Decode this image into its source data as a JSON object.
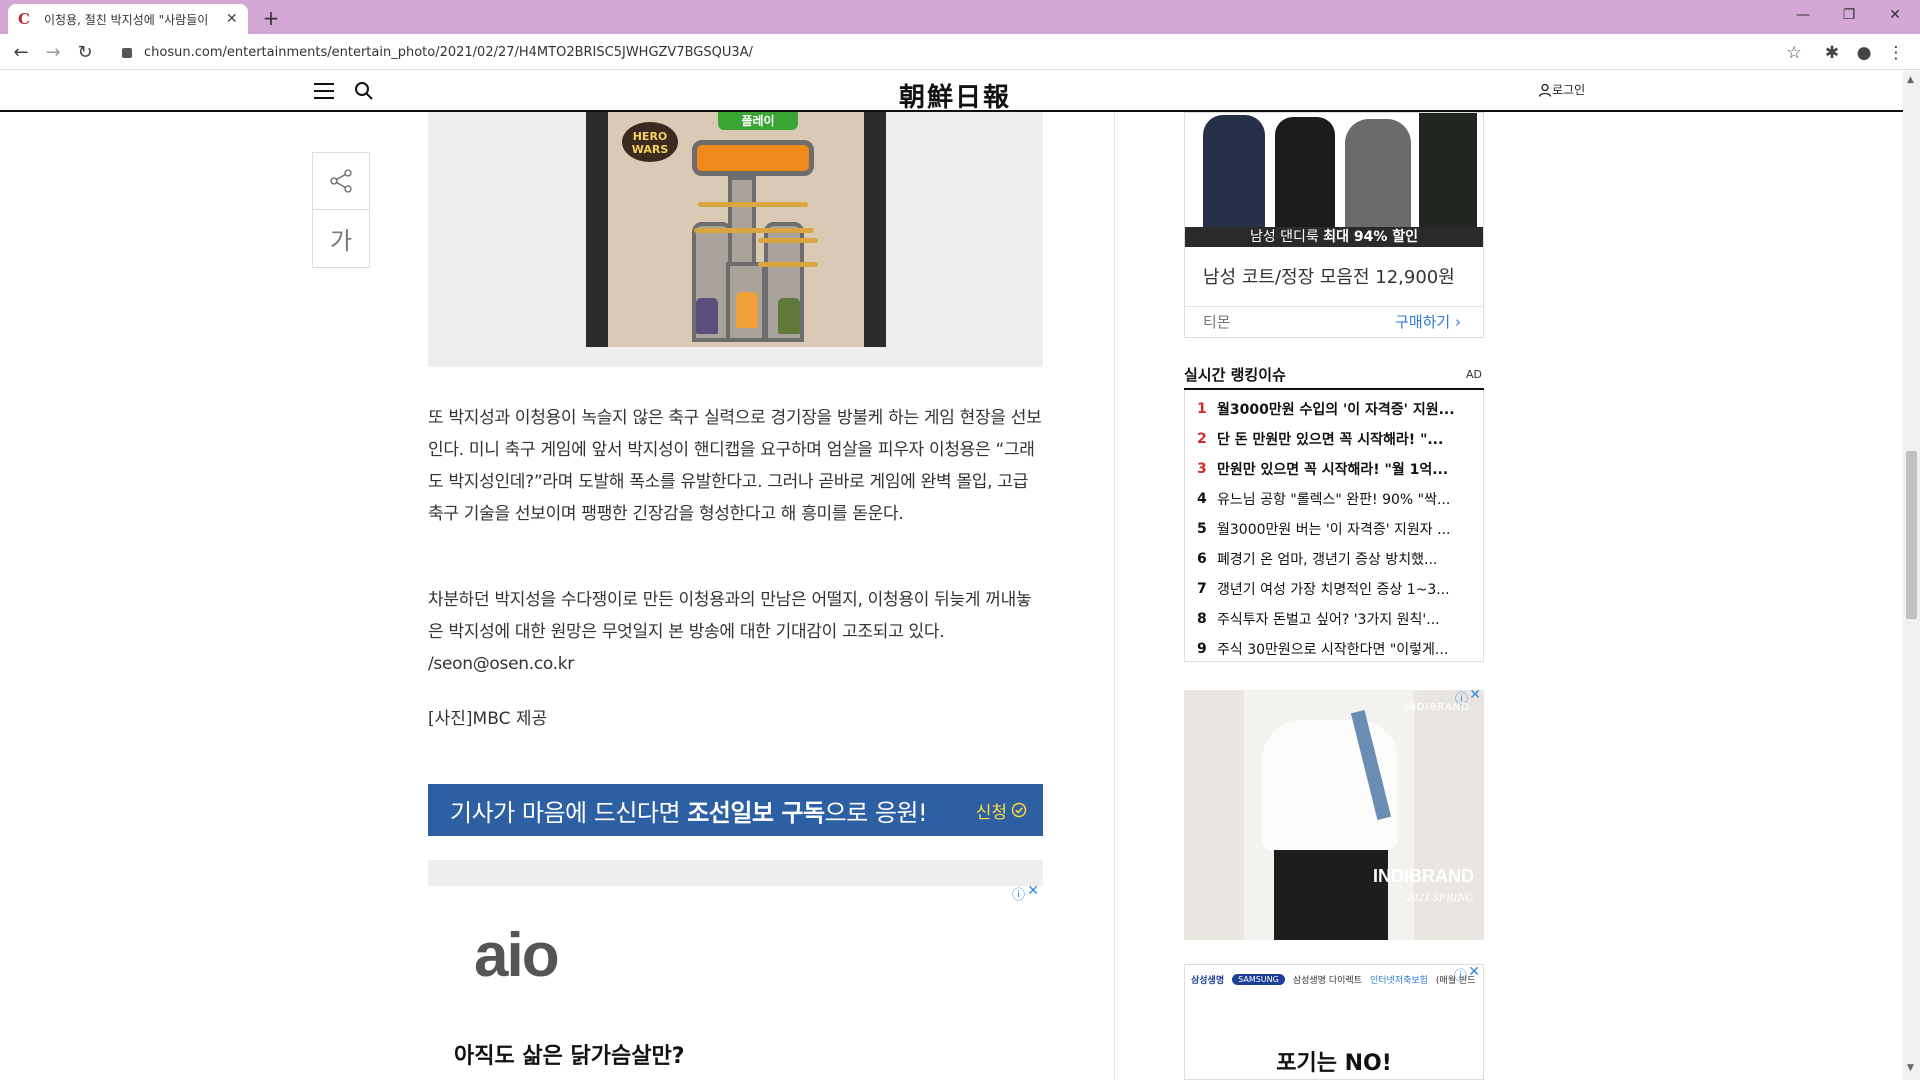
{
  "browser": {
    "tab_title": "이청용, 절친 박지성에 \"사람들이",
    "url": "chosun.com/entertainments/entertain_photo/2021/02/27/H4MTO2BRISC5JWHGZV7BGSQU3A/",
    "new_tab": "+",
    "tab_close": "✕"
  },
  "header": {
    "logo": "朝鮮日報",
    "login": "로그인"
  },
  "article": {
    "font_button": "가",
    "game_play": "플레이",
    "game_logo_1": "HERO",
    "game_logo_2": "WARS",
    "paragraph1": "또 박지성과 이청용이 녹슬지 않은 축구 실력으로 경기장을 방불케 하는 게임 현장을 선보인다. 미니 축구 게임에 앞서 박지성이 핸디캡을 요구하며 엄살을 피우자 이청용은 “그래도 박지성인데?”라며 도발해 폭소를 유발한다고. 그러나 곧바로 게임에 완벽 몰입, 고급 축구 기술을 선보이며 팽팽한 긴장감을 형성한다고 해 흥미를 돋운다.",
    "paragraph2": "차분하던 박지성을 수다쟁이로 만든 이청용과의 만남은 어떨지, 이청용이 뒤늦게 꺼내놓은 박지성에 대한 원망은 무엇일지 본 방송에 대한 기대감이 고조되고 있다. /seon@osen.co.kr",
    "caption": "[사진]MBC 제공",
    "subscribe_pre": "기사가 마음에 드신다면 ",
    "subscribe_bold": "조선일보 구독",
    "subscribe_post": "으로 응원!",
    "subscribe_apply": "신청"
  },
  "ad_aio": {
    "logo": "aio",
    "text": "아직도 삶은 닭가슴살만?"
  },
  "shop": {
    "banner_pre": "남성 댄디룩 ",
    "banner_bold": "최대 94% 할인",
    "title": "남성 코트/정장 모음전 12,900원",
    "vendor": "티몬",
    "buy": "구매하기"
  },
  "ranking": {
    "title": "실시간 랭킹이슈",
    "ad_label": "AD",
    "items": [
      {
        "num": "1",
        "text": "월3000만원 수입의 '이 자격증' 지원..."
      },
      {
        "num": "2",
        "text": "단 돈 만원만 있으면 꼭 시작해라! \"..."
      },
      {
        "num": "3",
        "text": "만원만 있으면 꼭 시작해라! \"월 1억..."
      },
      {
        "num": "4",
        "text": "유느님 공항 \"롤렉스\" 완판! 90% \"싹..."
      },
      {
        "num": "5",
        "text": "월3000만원 버는 '이 자격증' 지원자 ..."
      },
      {
        "num": "6",
        "text": "폐경기 온 엄마, 갱년기 증상 방치했..."
      },
      {
        "num": "7",
        "text": "갱년기 여성 가장 치명적인 증상 1~3..."
      },
      {
        "num": "8",
        "text": "주식투자 돈벌고 싶어? '3가지 원칙'..."
      },
      {
        "num": "9",
        "text": "주식 30만원으로 시작한다면 \"이렇게..."
      }
    ]
  },
  "ad_indi": {
    "brand_top": "INDIBRAND",
    "brand": "INDIBRAND",
    "season": "2021 SPRING"
  },
  "ad_samsung": {
    "brand": "삼성생명",
    "logo": "SAMSUNG",
    "product": "삼성생명 다이렉트",
    "link": "인터넷저축보험",
    "note": "(매월 반드",
    "headline": "포기는 NO!"
  },
  "colors": {
    "tabbar": "#d3a8d6",
    "subscribe_bg": "#2d5fa3",
    "rank_red": "#d82a2a",
    "buy_link": "#2e7bd6"
  }
}
